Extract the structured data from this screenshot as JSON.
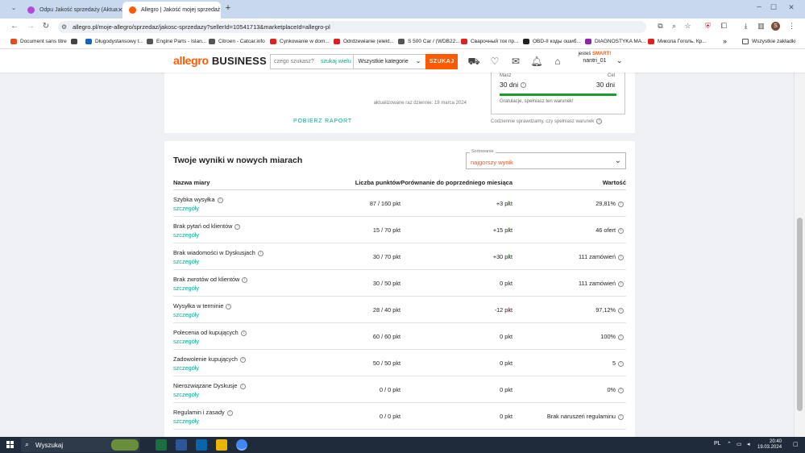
{
  "browser": {
    "tabs": [
      {
        "title": "Odpu Jakość sprzedaży (Aktua",
        "favicon_color": "#b44bd8",
        "active": false
      },
      {
        "title": "Allegro | Jakość mojej sprzedaż",
        "favicon_color": "#ff5a00",
        "active": true
      }
    ],
    "new_tab_symbol": "+",
    "url": "allegro.pl/moje-allegro/sprzedaz/jakosc-sprzedazy?sellerId=10541713&marketplaceId=allegro-pl",
    "bookmarks": [
      {
        "label": "Document sans titre",
        "color": "#e64a19"
      },
      {
        "label": "",
        "color": "#444444"
      },
      {
        "label": "Długodystansowy t...",
        "color": "#1565c0"
      },
      {
        "label": "Engine Parts - Islan...",
        "color": "#555555"
      },
      {
        "label": "Citroen - Catcar.info",
        "color": "#555555"
      },
      {
        "label": "Cynkowanie w dom...",
        "color": "#e02020"
      },
      {
        "label": "Odrdzewianie (elekt...",
        "color": "#e02020"
      },
      {
        "label": "S 500 Car / (WDB22...",
        "color": "#555555"
      },
      {
        "label": "Сварочный ток пр...",
        "color": "#e02020"
      },
      {
        "label": "OBD-II коды ошиб...",
        "color": "#222222"
      },
      {
        "label": "DIAGNOSTYKA MA...",
        "color": "#8e24aa"
      },
      {
        "label": "Микола Гоголь. Кр...",
        "color": "#e02020"
      }
    ],
    "bookmarks_more": "»",
    "all_bookmarks": "Wszystkie zakładki"
  },
  "site": {
    "logo_main": "allegro",
    "logo_sub": "BUSINESS",
    "search_placeholder": "czego szukasz?",
    "search_many": "szukaj wielu",
    "category": "Wszystkie kategorie",
    "search_button": "SZUKAJ",
    "smart_prefix": "jesteś",
    "smart_label": "SMART!",
    "username": "nantri_01"
  },
  "top": {
    "updated": "aktualizowane raz dziennie: 19 marca 2024",
    "download": "POBIERZ RAPORT",
    "have_label": "Masz",
    "have_value": "30 dni",
    "goal_label": "Cel",
    "goal_value": "30 dni",
    "progress": 1.0,
    "congrats": "Gratulacje, spełniasz ten warunek!",
    "daily_check": "Codziennie sprawdzamy, czy spełniasz warunek"
  },
  "results": {
    "title": "Twoje wyniki w nowych miarach",
    "sort_label": "Sortowanie",
    "sort_value": "najgorszy wynik",
    "headers": {
      "name": "Nazwa miary",
      "points": "Liczba punktów",
      "compare": "Porównanie do poprzedniego miesiąca",
      "value": "Wartość"
    },
    "details_label": "szczegóły",
    "rows": [
      {
        "name": "Szybka wysyłka",
        "points": "87 / 160 pkt",
        "compare": "+3 pkt",
        "trend": "up",
        "value": "29,81%"
      },
      {
        "name": "Brak pytań od klientów",
        "points": "15 / 70 pkt",
        "compare": "+15 pkt",
        "trend": "up",
        "value": "46 ofert"
      },
      {
        "name": "Brak wiadomości w Dyskusjach",
        "points": "30 / 70 pkt",
        "compare": "+30 pkt",
        "trend": "up",
        "value": "111 zamówień"
      },
      {
        "name": "Brak zwrotów od klientów",
        "points": "30 / 50 pkt",
        "compare": "0 pkt",
        "trend": "none",
        "value": "111 zamówień"
      },
      {
        "name": "Wysyłka w terminie",
        "points": "28 / 40 pkt",
        "compare": "-12 pkt",
        "trend": "down",
        "value": "97,12%"
      },
      {
        "name": "Polecenia od kupujących",
        "points": "60 / 60 pkt",
        "compare": "0 pkt",
        "trend": "none",
        "value": "100%"
      },
      {
        "name": "Zadowolenie kupujących",
        "points": "50 / 50 pkt",
        "compare": "0 pkt",
        "trend": "none",
        "value": "5"
      },
      {
        "name": "Nierozwiązane Dyskusje",
        "points": "0 / 0 pkt",
        "compare": "0 pkt",
        "trend": "none",
        "value": "0%"
      },
      {
        "name": "Regulamin i zasady",
        "points": "0 / 0 pkt",
        "compare": "0 pkt",
        "trend": "none",
        "value": "Brak naruszeń regulaminu"
      }
    ]
  },
  "taskbar": {
    "search_label": "Wyszukaj",
    "lang": "PL",
    "time": "20:40",
    "date": "19.03.2024"
  },
  "colors": {
    "accent": "#ff5a00",
    "link": "#00a790",
    "success": "#1a9e32",
    "danger": "#d13a28"
  }
}
